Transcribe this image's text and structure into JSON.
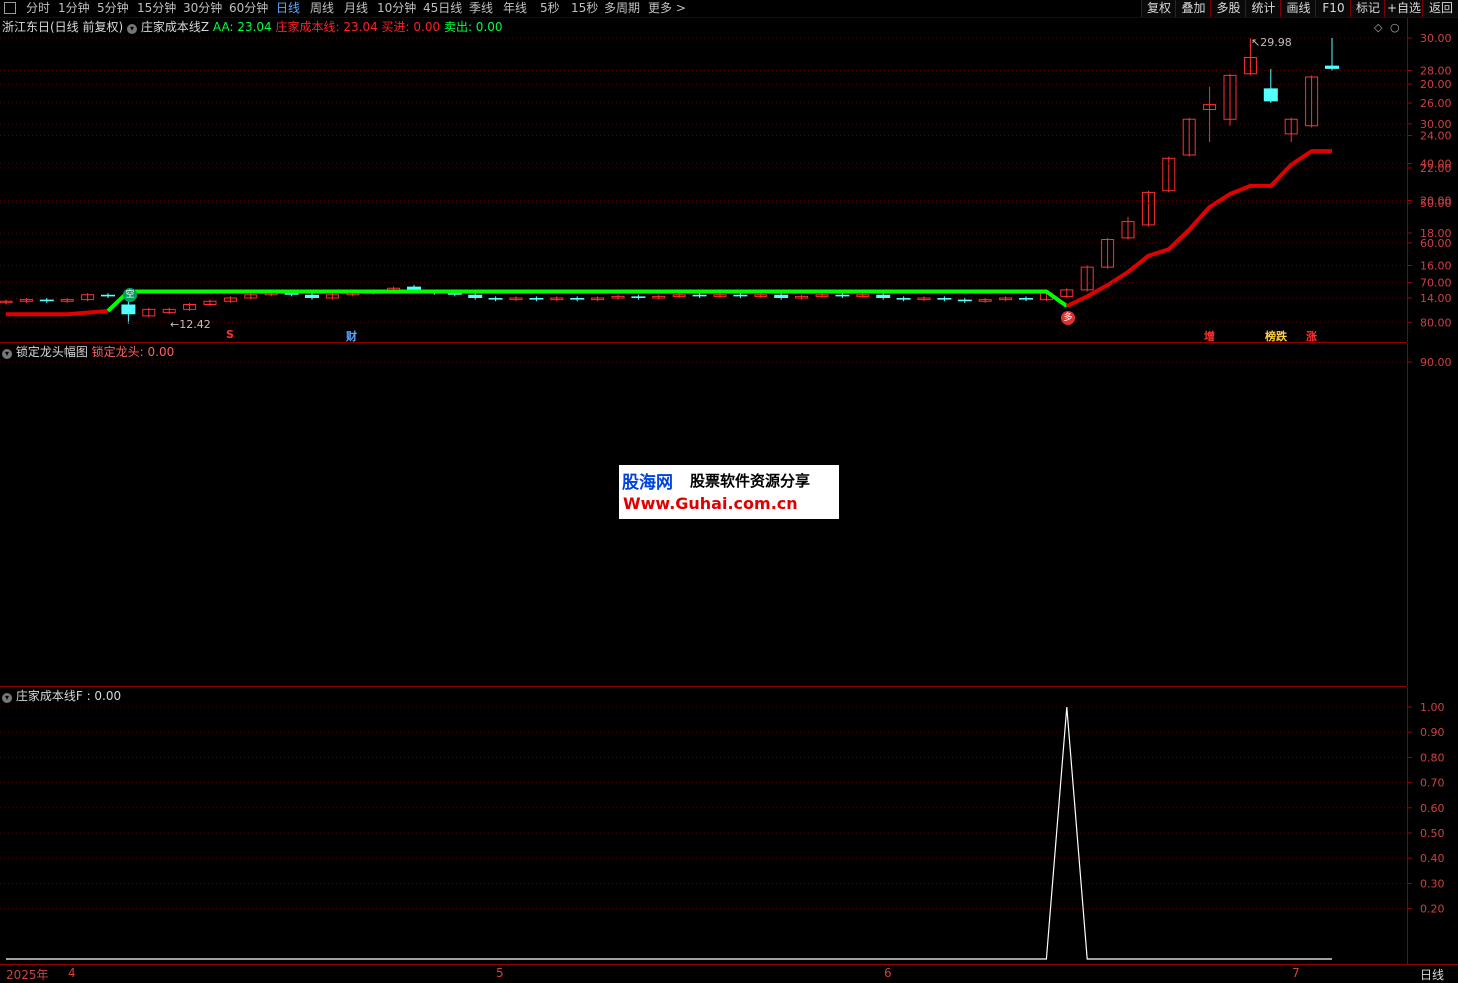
{
  "toolbar": {
    "periods": [
      "分时",
      "1分钟",
      "5分钟",
      "15分钟",
      "30分钟",
      "60分钟",
      "日线",
      "周线",
      "月线",
      "10分钟",
      "45日线",
      "季线",
      "年线",
      "5秒",
      "15秒",
      "多周期",
      "更多 >"
    ],
    "active_period": "日线",
    "right_buttons": [
      "复权",
      "叠加",
      "多股",
      "统计",
      "画线",
      "F10",
      "标记",
      "+自选",
      "返回"
    ]
  },
  "main_chart": {
    "stock_title": "浙江东日(日线 前复权)",
    "indicator_name": "庄家成本线Z",
    "aa_label": "AA: 23.04",
    "cost_label": "庄家成本线: 23.04",
    "buy_label": "买进: 0.00",
    "sell_label": "卖出: 0.00",
    "max_price_label": "29.98",
    "min_price_label": "12.42",
    "markers": {
      "s": "S",
      "cai": "财",
      "zeng": "增",
      "bangzhang": "榜跌",
      "zhang": "涨",
      "kong": "空",
      "duo": "多"
    },
    "colors": {
      "up": "#ff3030",
      "down": "#54ffff",
      "cost_line_red": "#e00000",
      "cost_line_green": "#00ff00"
    },
    "y_axis_ticks": [
      "30.00",
      "28.00",
      "26.00",
      "24.00",
      "22.00",
      "20.00",
      "18.00",
      "16.00",
      "14.00"
    ]
  },
  "panel2": {
    "title": "锁定龙头幅图",
    "value_label": "锁定龙头: 0.00",
    "y_axis_ticks": [
      "90.00",
      "80.00",
      "70.00",
      "60.00",
      "50.00",
      "40.00",
      "30.00",
      "20.00"
    ],
    "bar_segments": [
      {
        "from": 10,
        "to": 30,
        "color": "#ffff00"
      },
      {
        "from": 30,
        "to": 60,
        "color": "#ff0000"
      },
      {
        "from": 60,
        "to": 90,
        "color": "#ff00ff"
      }
    ]
  },
  "panel3": {
    "title": "庄家成本线F",
    "value_label": ": 0.00",
    "y_axis_ticks": [
      "1.00",
      "0.90",
      "0.80",
      "0.70",
      "0.60",
      "0.50",
      "0.40",
      "0.30",
      "0.20"
    ]
  },
  "watermark": {
    "line1_a": "股海网",
    "line1_b": "股票软件资源分享",
    "line2": "Www.Guhai.com.cn"
  },
  "date_axis": {
    "year_label": "2025年",
    "months": [
      "4",
      "5",
      "6",
      "7"
    ],
    "period_label": "日线"
  },
  "chart_data": {
    "type": "candlestick",
    "ylim": [
      12.0,
      31.0
    ],
    "candles": [
      [
        13.8,
        13.8,
        13.9,
        13.6
      ],
      [
        13.8,
        13.9,
        14.0,
        13.7
      ],
      [
        13.9,
        13.8,
        14.0,
        13.7
      ],
      [
        13.8,
        13.9,
        14.0,
        13.7
      ],
      [
        13.9,
        14.2,
        14.3,
        13.8
      ],
      [
        14.2,
        14.1,
        14.3,
        14.0
      ],
      [
        13.6,
        13.0,
        14.1,
        12.42
      ],
      [
        12.9,
        13.3,
        13.4,
        12.8
      ],
      [
        13.1,
        13.3,
        13.4,
        13.0
      ],
      [
        13.3,
        13.6,
        13.7,
        13.2
      ],
      [
        13.6,
        13.8,
        13.9,
        13.5
      ],
      [
        13.8,
        14.0,
        14.1,
        13.7
      ],
      [
        14.0,
        14.2,
        14.3,
        13.9
      ],
      [
        14.2,
        14.3,
        14.4,
        14.1
      ],
      [
        14.3,
        14.2,
        14.4,
        14.1
      ],
      [
        14.2,
        14.0,
        14.3,
        13.9
      ],
      [
        14.0,
        14.2,
        14.3,
        13.9
      ],
      [
        14.2,
        14.3,
        14.4,
        14.1
      ],
      [
        14.3,
        14.4,
        14.5,
        14.2
      ],
      [
        14.4,
        14.6,
        14.7,
        14.3
      ],
      [
        14.7,
        14.4,
        14.8,
        14.3
      ],
      [
        14.4,
        14.3,
        14.5,
        14.2
      ],
      [
        14.3,
        14.2,
        14.4,
        14.1
      ],
      [
        14.2,
        14.0,
        14.3,
        13.9
      ],
      [
        14.0,
        13.9,
        14.1,
        13.8
      ],
      [
        13.9,
        14.0,
        14.1,
        13.8
      ],
      [
        14.0,
        13.9,
        14.1,
        13.8
      ],
      [
        13.9,
        14.0,
        14.1,
        13.8
      ],
      [
        14.0,
        13.9,
        14.1,
        13.8
      ],
      [
        13.9,
        14.0,
        14.1,
        13.8
      ],
      [
        14.0,
        14.1,
        14.2,
        13.9
      ],
      [
        14.1,
        14.0,
        14.2,
        13.9
      ],
      [
        14.0,
        14.1,
        14.2,
        13.9
      ],
      [
        14.1,
        14.2,
        14.3,
        14.0
      ],
      [
        14.2,
        14.1,
        14.3,
        14.0
      ],
      [
        14.1,
        14.2,
        14.3,
        14.0
      ],
      [
        14.2,
        14.1,
        14.3,
        14.0
      ],
      [
        14.1,
        14.2,
        14.3,
        14.0
      ],
      [
        14.2,
        14.0,
        14.3,
        13.9
      ],
      [
        14.0,
        14.1,
        14.2,
        13.9
      ],
      [
        14.1,
        14.2,
        14.3,
        14.0
      ],
      [
        14.2,
        14.1,
        14.3,
        14.0
      ],
      [
        14.1,
        14.2,
        14.3,
        14.0
      ],
      [
        14.2,
        14.0,
        14.3,
        13.9
      ],
      [
        14.0,
        13.9,
        14.1,
        13.8
      ],
      [
        13.9,
        14.0,
        14.1,
        13.8
      ],
      [
        14.0,
        13.9,
        14.1,
        13.8
      ],
      [
        13.9,
        13.8,
        14.0,
        13.7
      ],
      [
        13.8,
        13.9,
        14.0,
        13.7
      ],
      [
        13.9,
        14.0,
        14.1,
        13.8
      ],
      [
        14.0,
        13.9,
        14.1,
        13.8
      ],
      [
        13.9,
        14.3,
        14.4,
        13.8
      ],
      [
        14.1,
        14.5,
        14.6,
        14.0
      ],
      [
        14.5,
        15.9,
        16.0,
        14.4
      ],
      [
        15.9,
        17.6,
        17.7,
        15.8
      ],
      [
        17.7,
        18.7,
        19.0,
        17.6
      ],
      [
        18.5,
        20.5,
        20.6,
        18.4
      ],
      [
        20.6,
        22.6,
        22.7,
        20.5
      ],
      [
        22.8,
        25.0,
        25.1,
        22.7
      ],
      [
        25.6,
        25.9,
        27.0,
        23.6
      ],
      [
        25.0,
        27.7,
        27.8,
        24.6
      ],
      [
        27.8,
        28.8,
        29.98,
        27.7
      ],
      [
        26.9,
        26.1,
        28.1,
        26.0
      ],
      [
        24.1,
        25.0,
        25.1,
        23.6
      ],
      [
        24.6,
        27.6,
        27.7,
        24.5
      ],
      [
        28.3,
        28.1,
        30.0,
        28.0
      ]
    ],
    "cost_line": [
      13.0,
      13.0,
      13.0,
      13.0,
      13.1,
      13.2,
      14.4,
      14.4,
      14.4,
      14.4,
      14.4,
      14.4,
      14.4,
      14.4,
      14.4,
      14.4,
      14.4,
      14.4,
      14.4,
      14.4,
      14.4,
      14.4,
      14.4,
      14.4,
      14.4,
      14.4,
      14.4,
      14.4,
      14.4,
      14.4,
      14.4,
      14.4,
      14.4,
      14.4,
      14.4,
      14.4,
      14.4,
      14.4,
      14.4,
      14.4,
      14.4,
      14.4,
      14.4,
      14.4,
      14.4,
      14.4,
      14.4,
      14.4,
      14.4,
      14.4,
      14.4,
      14.4,
      13.5,
      14.1,
      14.8,
      15.6,
      16.6,
      17.0,
      18.2,
      19.6,
      20.4,
      20.9,
      20.9,
      22.2,
      23.04,
      23.04,
      23.04,
      23.04
    ],
    "cost_line_green_range": [
      5,
      52
    ],
    "bar_panel_value_range": [
      10,
      90
    ],
    "spike_panel": {
      "ylim": [
        0,
        1.05
      ],
      "spike_index": 52,
      "spike_value": 1.0
    }
  }
}
